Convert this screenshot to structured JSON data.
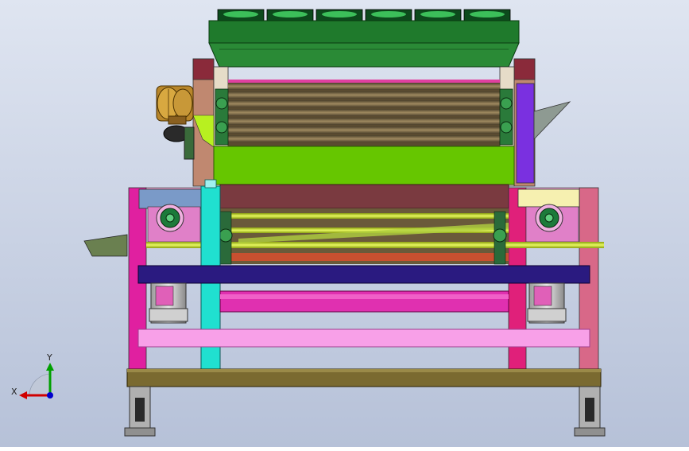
{
  "scene": {
    "type": "cad-3d-assembly-view",
    "view": "front",
    "background_top": "#d9e0ee",
    "background_bottom": "#b9c4da"
  },
  "triad": {
    "x_label": "X",
    "y_label": "Y",
    "x_color": "#d00000",
    "y_color": "#00a000",
    "z_color": "#0000cc"
  },
  "parts": [
    {
      "name": "cooling-fan-row",
      "color": "#0a5a20"
    },
    {
      "name": "top-hood",
      "color": "#1f7a2c"
    },
    {
      "name": "upper-roller-bank",
      "color": "#6b5a3a"
    },
    {
      "name": "green-guard-panel",
      "color": "#66c600"
    },
    {
      "name": "maroon-panel",
      "color": "#7a3a40"
    },
    {
      "name": "drive-gearbox",
      "color": "#b8862a"
    },
    {
      "name": "pink-frame",
      "color": "#e020a0"
    },
    {
      "name": "cyan-post",
      "color": "#20e0d0"
    },
    {
      "name": "navy-crossbeam",
      "color": "#2a1a80"
    },
    {
      "name": "light-pink-beam",
      "color": "#f8a0e8"
    },
    {
      "name": "olive-base-plate",
      "color": "#7a6a30"
    },
    {
      "name": "yellow-green-shafts",
      "color": "#c8e020"
    },
    {
      "name": "motor-units",
      "color": "#c0c0c0"
    },
    {
      "name": "leveling-feet",
      "color": "#909090"
    },
    {
      "name": "purple-side-panel",
      "color": "#7a30e0"
    },
    {
      "name": "output-chute",
      "color": "#909a90"
    },
    {
      "name": "input-chute",
      "color": "#6a8050"
    }
  ]
}
